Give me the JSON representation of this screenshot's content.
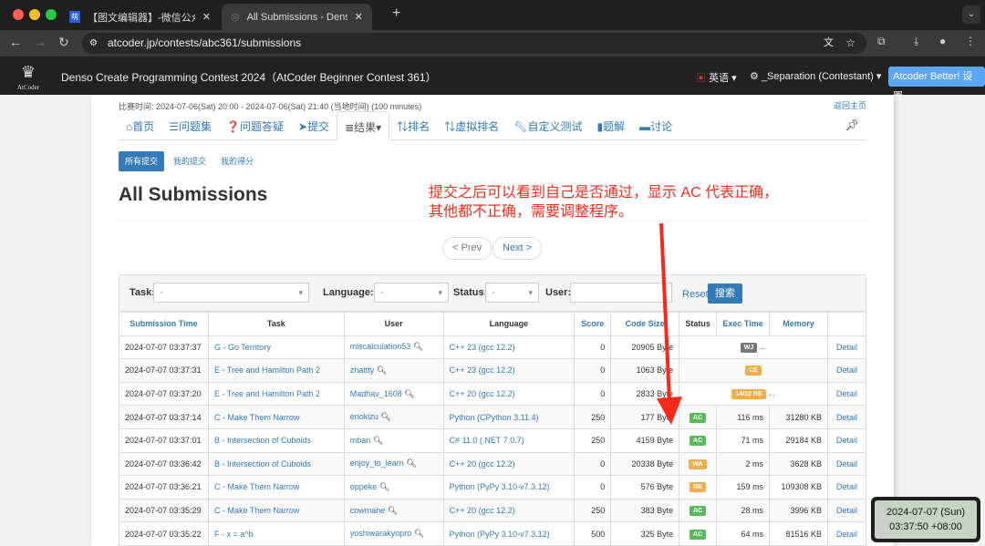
{
  "browser": {
    "tabs": [
      {
        "icon": "萌",
        "title": "【图文编辑器】-微信公众号图文"
      },
      {
        "title": "All Submissions - Denso Crea"
      }
    ],
    "url": "atcoder.jp/contests/abc361/submissions"
  },
  "navbar": {
    "logo": "AtCoder",
    "contest": "Denso Create Programming Contest 2024（AtCoder Beginner Contest 361）",
    "language": "英语",
    "user": "_Separation (Contestant)",
    "better_button": "Atcoder Better! 设置"
  },
  "contest_time": "比赛时间: 2024-07-06(Sat) 20:00 - 2024-07-06(Sat) 21:40 (当地时间) (100 minutes)",
  "back_home": "返回主页",
  "tabs": [
    "首页",
    "问题集",
    "问题答疑",
    "提交",
    "结果",
    "排名",
    "虚拟排名",
    "自定义测试",
    "题解",
    "讨论"
  ],
  "subtabs": [
    "所有提交",
    "我的提交",
    "我的得分"
  ],
  "title": "All Submissions",
  "annotation": [
    "提交之后可以看到自己是否通过，显示 AC 代表正确，",
    "其他都不正确，需要调整程序。"
  ],
  "pager": {
    "prev": "< Prev",
    "next": "Next >"
  },
  "filter": {
    "task_label": "Task:",
    "task_value": "-",
    "language_label": "Language:",
    "language_value": "-",
    "status_label": "Status:",
    "status_value": "-",
    "user_label": "User:",
    "user_value": "",
    "reset": "Reset",
    "search": "搜索"
  },
  "columns": [
    "Submission Time",
    "Task",
    "User",
    "Language",
    "Score",
    "Code Size",
    "Status",
    "Exec Time",
    "Memory",
    ""
  ],
  "rows": [
    [
      "2024-07-07 03:37:37",
      "G - Go Territory",
      "miscalculation53",
      "C++ 23 (gcc 12.2)",
      "0",
      "20905 Byte",
      "WJ",
      "",
      "",
      "Detail"
    ],
    [
      "2024-07-07 03:37:31",
      "E - Tree and Hamilton Path 2",
      "zhattty",
      "C++ 23 (gcc 12.2)",
      "0",
      "1063 Byte",
      "CE",
      "",
      "",
      "Detail"
    ],
    [
      "2024-07-07 03:37:20",
      "E - Tree and Hamilton Path 2",
      "Madhav_1608",
      "C++ 20 (gcc 12.2)",
      "0",
      "2833 Byte",
      "14/32 RE",
      "",
      "",
      "Detail"
    ],
    [
      "2024-07-07 03:37:14",
      "C - Make Them Narrow",
      "enokizu",
      "Python (CPython 3.11.4)",
      "250",
      "177 Byte",
      "AC",
      "116 ms",
      "31280 KB",
      "Detail"
    ],
    [
      "2024-07-07 03:37:01",
      "B - Intersection of Cuboids",
      "mban",
      "C# 11.0 (.NET 7.0.7)",
      "250",
      "4159 Byte",
      "AC",
      "71 ms",
      "29184 KB",
      "Detail"
    ],
    [
      "2024-07-07 03:36:42",
      "B - Intersection of Cuboids",
      "enjoy_to_learn",
      "C++ 20 (gcc 12.2)",
      "0",
      "20338 Byte",
      "WA",
      "2 ms",
      "3628 KB",
      "Detail"
    ],
    [
      "2024-07-07 03:36:21",
      "C - Make Them Narrow",
      "oppeke",
      "Python (PyPy 3.10-v7.3.12)",
      "0",
      "576 Byte",
      "RE",
      "159 ms",
      "109308 KB",
      "Detail"
    ],
    [
      "2024-07-07 03:35:29",
      "C - Make Them Narrow",
      "cowmane",
      "C++ 20 (gcc 12.2)",
      "250",
      "383 Byte",
      "AC",
      "28 ms",
      "3996 KB",
      "Detail"
    ],
    [
      "2024-07-07 03:35:22",
      "F - x = a^b",
      "yoshiwarakyopro",
      "Python (PyPy 3.10-v7.3.12)",
      "500",
      "325 Byte",
      "AC",
      "64 ms",
      "81516 KB",
      "Detail"
    ]
  ],
  "status_colors": {
    "AC": "#5cb85c",
    "WA": "#f0ad4e",
    "RE": "#f0ad4e",
    "CE": "#f0ad4e",
    "14/32 RE": "#f0ad4e",
    "WJ": "#777777"
  },
  "ellipsis": "...",
  "clock": {
    "date": "2024-07-07 (Sun)",
    "time": "03:37:50 +08:00"
  }
}
